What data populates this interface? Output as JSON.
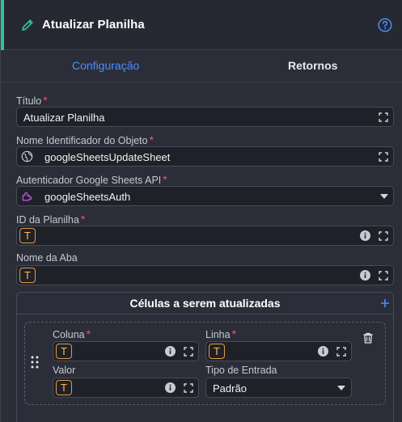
{
  "header": {
    "title": "Atualizar Planilha",
    "accent_color": "#2ec4a0"
  },
  "tabs": [
    {
      "label": "Configuração",
      "active": true
    },
    {
      "label": "Retornos",
      "active": false
    }
  ],
  "fields": {
    "titulo": {
      "label": "Título",
      "required_mark": "*",
      "value": "Atualizar Planilha"
    },
    "nome_identificador": {
      "label": "Nome Identificador do Objeto",
      "required_mark": "*",
      "value": "googleSheetsUpdateSheet",
      "icon": "globe-icon"
    },
    "autenticador": {
      "label": "Autenticador Google Sheets API",
      "required_mark": "*",
      "value": "googleSheetsAuth",
      "icon": "auth-puzzle-icon"
    },
    "id_planilha": {
      "label": "ID da Planilha",
      "required_mark": "*",
      "type_icon": "T",
      "value": ""
    },
    "nome_aba": {
      "label": "Nome da Aba",
      "type_icon": "T",
      "value": ""
    }
  },
  "cells_group": {
    "title": "Células a serem atualizadas",
    "item": {
      "coluna": {
        "label": "Coluna",
        "required_mark": "*",
        "type_icon": "T",
        "value": ""
      },
      "linha": {
        "label": "Linha",
        "required_mark": "*",
        "type_icon": "T",
        "value": ""
      },
      "valor": {
        "label": "Valor",
        "type_icon": "T",
        "value": ""
      },
      "tipo_entrada": {
        "label": "Tipo de Entrada",
        "value": "Padrão"
      }
    }
  },
  "colors": {
    "active_tab": "#4d8dff",
    "required": "#ff4d5e",
    "type_icon": "#ffb65a"
  }
}
